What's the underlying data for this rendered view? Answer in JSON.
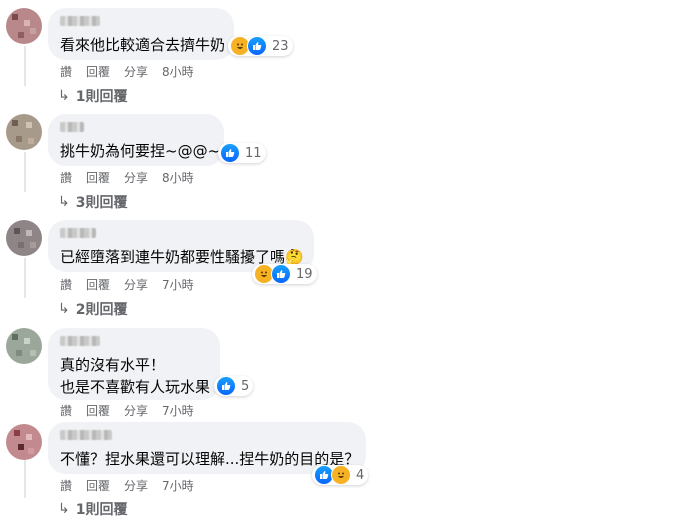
{
  "actions": {
    "like": "讚",
    "reply": "回覆",
    "share": "分享"
  },
  "comments": [
    {
      "text_lines": [
        "看來他比較適合去擠牛奶"
      ],
      "reaction_count": "23",
      "time": "8小時",
      "replies": "1則回覆"
    },
    {
      "text_lines": [
        "挑牛奶為何要捏~@@~"
      ],
      "reaction_count": "11",
      "time": "8小時",
      "replies": "3則回覆"
    },
    {
      "text_lines": [
        "已經墮落到連牛奶都要性騷擾了嗎🤔"
      ],
      "reaction_count": "19",
      "time": "7小時",
      "replies": "2則回覆"
    },
    {
      "text_lines": [
        "真的沒有水平！",
        "也是不喜歡有人玩水果"
      ],
      "reaction_count": "5",
      "time": "7小時",
      "replies": ""
    },
    {
      "text_lines": [
        "不懂？捏水果還可以理解...捏牛奶的目的是？"
      ],
      "reaction_count": "4",
      "time": "7小時",
      "replies": "1則回覆"
    }
  ]
}
